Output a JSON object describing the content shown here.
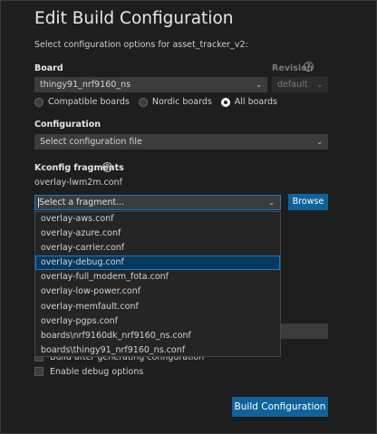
{
  "header": {
    "title": "Edit Build Configuration",
    "subtitle": "Select configuration options for asset_tracker_v2:"
  },
  "board": {
    "label": "Board",
    "value": "thingy91_nrf9160_ns",
    "revision_label": "Revision",
    "revision_value": "default",
    "radios": [
      {
        "label": "Compatible boards",
        "checked": false
      },
      {
        "label": "Nordic boards",
        "checked": false
      },
      {
        "label": "All boards",
        "checked": true
      }
    ]
  },
  "configuration": {
    "label": "Configuration",
    "value": "Select configuration file"
  },
  "kconfig": {
    "label": "Kconfig fragments",
    "selected": "overlay-lwm2m.conf",
    "placeholder": "Select a fragment...",
    "browse_label": "Browse",
    "options": [
      "overlay-aws.conf",
      "overlay-azure.conf",
      "overlay-carrier.conf",
      "overlay-debug.conf",
      "overlay-full_modem_fota.conf",
      "overlay-low-power.conf",
      "overlay-memfault.conf",
      "overlay-pgps.conf",
      "boards\\nrf9160dk_nrf9160_ns.conf",
      "boards\\thingy91_nrf9160_ns.conf"
    ],
    "highlighted_option": "overlay-debug.conf"
  },
  "options": {
    "build_after_label": "Build after generating configuration",
    "debug_label": "Enable debug options"
  },
  "footer": {
    "build_button": "Build Configuration"
  },
  "colors": {
    "background": "#1e1e1e",
    "input_bg": "#3c3c3c",
    "accent": "#0e639c",
    "focus_border": "#0e7fd6",
    "highlight": "#04395e"
  }
}
